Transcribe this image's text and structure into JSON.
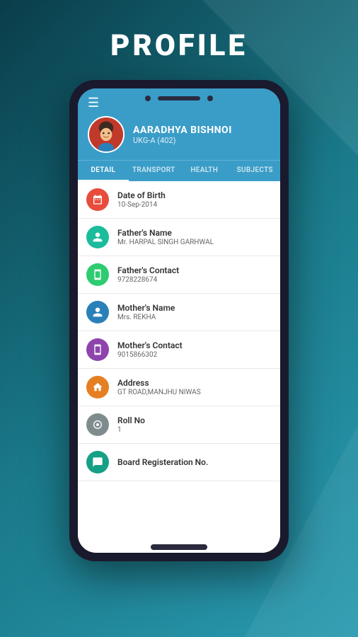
{
  "page": {
    "title": "PROFILE"
  },
  "student": {
    "name": "AARADHYA BISHNOI",
    "class": "UKG-A (402)"
  },
  "tabs": [
    {
      "id": "detail",
      "label": "DETAIL",
      "active": true
    },
    {
      "id": "transport",
      "label": "TRANSPORT",
      "active": false
    },
    {
      "id": "health",
      "label": "HEALTH",
      "active": false
    },
    {
      "id": "subjects",
      "label": "SUBJECTS",
      "active": false
    }
  ],
  "details": [
    {
      "label": "Date of Birth",
      "value": "10-Sep-2014",
      "icon": "calendar",
      "icon_class": "icon-red",
      "icon_char": "📅"
    },
    {
      "label": "Father's Name",
      "value": "Mr. HARPAL SINGH GARHWAL",
      "icon": "person",
      "icon_class": "icon-teal",
      "icon_char": "👤"
    },
    {
      "label": "Father's Contact",
      "value": "9728228674",
      "icon": "phone",
      "icon_class": "icon-green",
      "icon_char": "📱"
    },
    {
      "label": "Mother's Name",
      "value": "Mrs. REKHA",
      "icon": "person",
      "icon_class": "icon-blue-dark",
      "icon_char": "👤"
    },
    {
      "label": "Mother's Contact",
      "value": "9015866302",
      "icon": "phone",
      "icon_class": "icon-purple",
      "icon_char": "📱"
    },
    {
      "label": "Address",
      "value": "GT ROAD,MANJHU NIWAS",
      "icon": "home",
      "icon_class": "icon-orange",
      "icon_char": "🏠"
    },
    {
      "label": "Roll No",
      "value": "1",
      "icon": "circle",
      "icon_class": "icon-gray",
      "icon_char": "⊙"
    },
    {
      "label": "Board Registeration No.",
      "value": "",
      "icon": "id",
      "icon_class": "icon-cyan",
      "icon_char": "🪪"
    }
  ],
  "icons": {
    "menu": "☰",
    "calendar": "📅",
    "person_male": "♂",
    "phone_mobile": "📱",
    "person_female": "♀",
    "home_sym": "⌂",
    "roll": "◎",
    "board": "🔖"
  }
}
